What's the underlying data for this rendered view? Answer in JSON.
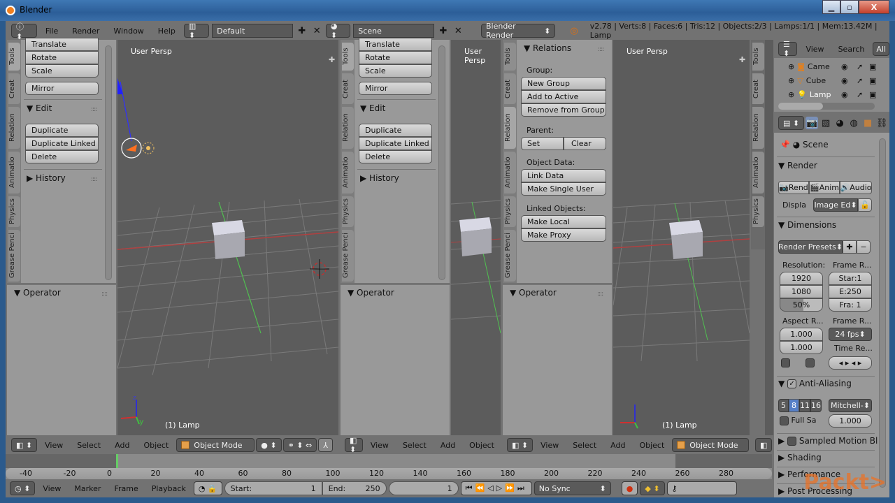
{
  "window": {
    "title": "Blender",
    "controls": [
      "minimize",
      "maximize",
      "close"
    ]
  },
  "infobar": {
    "menus": [
      "File",
      "Render",
      "Window",
      "Help"
    ],
    "layout": "Default",
    "scene": "Scene",
    "engine": "Blender Render",
    "stats": "v2.78 | Verts:8 | Faces:6 | Tris:12 | Objects:2/3 | Lamps:1/1 | Mem:13.42M | Lamp"
  },
  "toolshelf": {
    "tabs": [
      "Tools",
      "Creat",
      "Relation",
      "Animatio",
      "Physics",
      "Grease Penci"
    ],
    "transform_buttons": [
      "Translate",
      "Rotate",
      "Scale"
    ],
    "mirror": "Mirror",
    "edit_title": "Edit",
    "edit_buttons": [
      "Duplicate",
      "Duplicate Linked",
      "Delete"
    ],
    "history_title": "History",
    "operator_title": "Operator"
  },
  "relations": {
    "title": "Relations",
    "group_label": "Group:",
    "group_buttons": [
      "New Group",
      "Add to Active",
      "Remove from Group"
    ],
    "parent_label": "Parent:",
    "parent_set": "Set",
    "parent_clear": "Clear",
    "objdata_label": "Object Data:",
    "objdata_buttons": [
      "Link Data",
      "Make Single User"
    ],
    "linked_label": "Linked Objects:",
    "linked_buttons": [
      "Make Local",
      "Make Proxy"
    ],
    "operator_title": "Operator"
  },
  "viewport": {
    "view_name": "User Persp",
    "active_object": "(1) Lamp",
    "axis_z": "z",
    "axis_y": "y"
  },
  "view3d_header": {
    "menus": [
      "View",
      "Select",
      "Add",
      "Object"
    ],
    "mode": "Object Mode"
  },
  "timeline": {
    "ticks": [
      "-40",
      "-20",
      "0",
      "20",
      "40",
      "60",
      "80",
      "100",
      "120",
      "140",
      "160",
      "180",
      "200",
      "220",
      "240",
      "260",
      "280"
    ],
    "menus": [
      "View",
      "Marker",
      "Frame",
      "Playback"
    ],
    "start_label": "Start:",
    "start": "1",
    "end_label": "End:",
    "end": "250",
    "current": "1",
    "sync": "No Sync"
  },
  "outliner": {
    "menus": [
      "View",
      "Search",
      "All"
    ],
    "items": [
      {
        "name": "Came"
      },
      {
        "name": "Cube"
      },
      {
        "name": "Lamp"
      }
    ]
  },
  "properties": {
    "context": "Scene",
    "render_title": "Render",
    "render_buttons": [
      "Rend",
      "Anim",
      "Audio"
    ],
    "display_label": "Displa",
    "display_value": "Image Ed",
    "dimensions_title": "Dimensions",
    "presets": "Render Presets",
    "resolution_label": "Resolution:",
    "res_x": "1920",
    "res_y": "1080",
    "res_pct": "50%",
    "frame_range_label": "Frame R...",
    "frame_start": "Star:1",
    "frame_end": "E:250",
    "frame_step": "Fra: 1",
    "aspect_label": "Aspect R...",
    "aspect_x": "1.000",
    "aspect_y": "1.000",
    "frame_rate_label": "Frame R...",
    "fps": "24 fps",
    "time_remap_label": "Time Re...",
    "aa_title": "Anti-Aliasing",
    "aa_samples": [
      "5",
      "8",
      "11",
      "16"
    ],
    "aa_filter": "Mitchell-",
    "full_sample": "Full Sa",
    "filter_size": "1.000",
    "collapsed": [
      "Sampled Motion Bl",
      "Shading",
      "Performance",
      "Post Processing"
    ]
  },
  "watermark": "Packt>"
}
